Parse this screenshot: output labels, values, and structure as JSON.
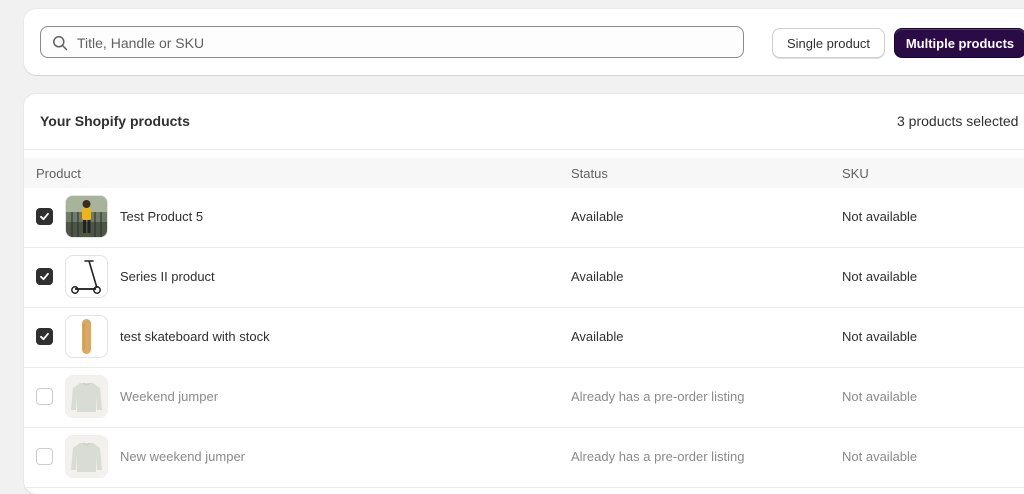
{
  "search": {
    "placeholder": "Title, Handle or SKU",
    "value": ""
  },
  "toolbar": {
    "single_label": "Single product",
    "multiple_label": "Multiple products"
  },
  "products_card": {
    "title": "Your Shopify products",
    "selected_count": "3 products selected"
  },
  "table": {
    "columns": [
      "Product",
      "Status",
      "SKU"
    ],
    "rows": [
      {
        "name": "Test Product 5",
        "status": "Available",
        "sku": "Not available",
        "checked": true,
        "thumbnail": "person-photo"
      },
      {
        "name": "Series II product",
        "status": "Available",
        "sku": "Not available",
        "checked": true,
        "thumbnail": "scooter"
      },
      {
        "name": "test skateboard with stock",
        "status": "Available",
        "sku": "Not available",
        "checked": true,
        "thumbnail": "skateboard"
      },
      {
        "name": "Weekend jumper",
        "status": "Already has a pre-order listing",
        "sku": "Not available",
        "checked": false,
        "thumbnail": "jumper"
      },
      {
        "name": "New weekend jumper",
        "status": "Already has a pre-order listing",
        "sku": "Not available",
        "checked": false,
        "thumbnail": "jumper"
      }
    ]
  },
  "colors": {
    "primary_button": "#2a0b45",
    "checkbox_checked": "#303030",
    "page_background": "#f1f1f1"
  }
}
